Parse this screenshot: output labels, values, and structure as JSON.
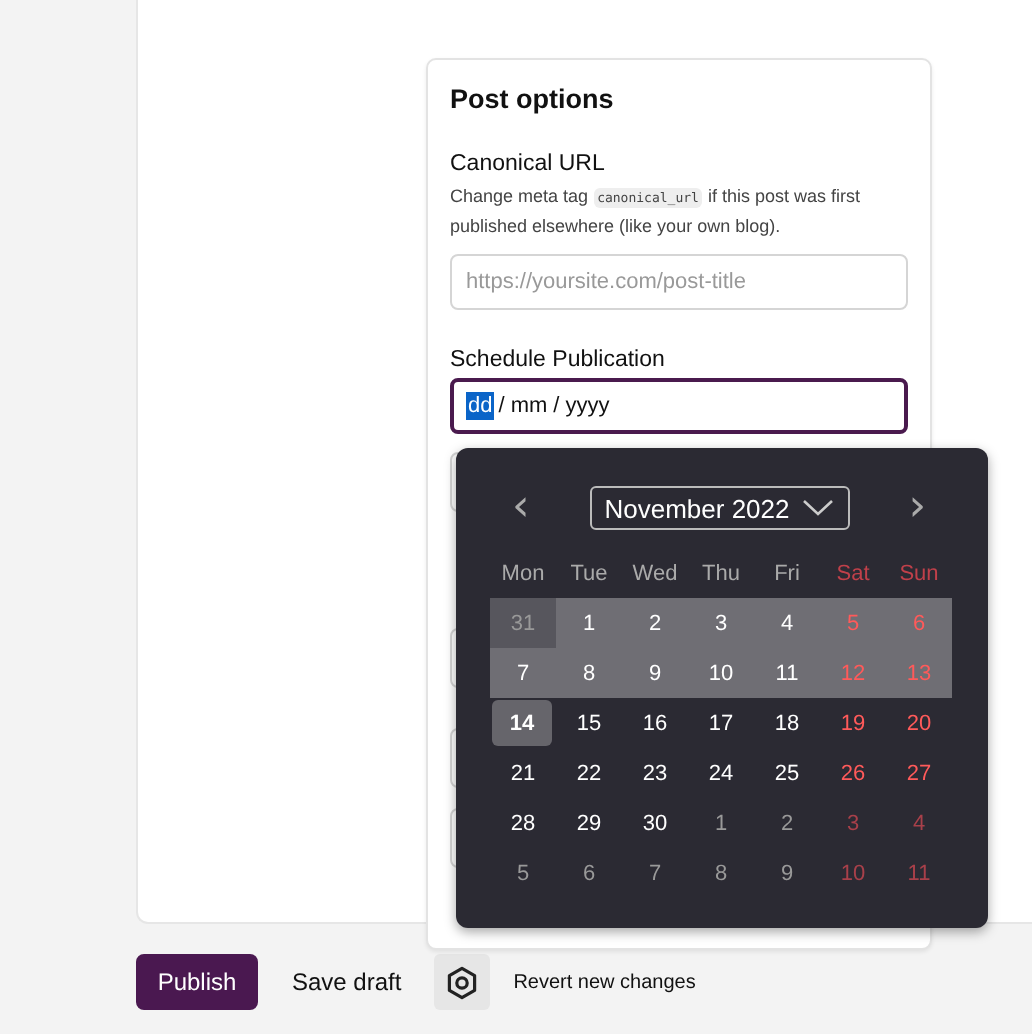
{
  "post_options": {
    "title": "Post options",
    "canonical_url": {
      "label": "Canonical URL",
      "help_before": "Change meta tag",
      "help_code": "canonical_url",
      "help_after": "if this post was first published elsewhere (like your own blog).",
      "placeholder": "https://yoursite.com/post-title"
    },
    "schedule": {
      "label": "Schedule Publication",
      "value_parts": [
        {
          "text": "dd",
          "selected": true
        },
        {
          "text": "/",
          "selected": false
        },
        {
          "text": "mm",
          "selected": false
        },
        {
          "text": "/",
          "selected": false
        },
        {
          "text": "yyyy",
          "selected": false
        }
      ]
    }
  },
  "calendar": {
    "month": "November 2022",
    "prev": "‹",
    "next": "›",
    "weekdays": [
      {
        "text": "Mon",
        "weekend": false
      },
      {
        "text": "Tue",
        "weekend": false
      },
      {
        "text": "Wed",
        "weekend": false
      },
      {
        "text": "Thu",
        "weekend": false
      },
      {
        "text": "Fri",
        "weekend": false
      },
      {
        "text": "Sat",
        "weekend": true
      },
      {
        "text": "Sun",
        "weekend": true
      }
    ],
    "weeks": [
      [
        {
          "day": "31",
          "in_month": false,
          "in_range": true,
          "selected": false
        },
        {
          "day": "1",
          "in_month": true,
          "in_range": true,
          "selected": false
        },
        {
          "day": "2",
          "in_month": true,
          "in_range": true,
          "selected": false
        },
        {
          "day": "3",
          "in_month": true,
          "in_range": true,
          "selected": false
        },
        {
          "day": "4",
          "in_month": true,
          "in_range": true,
          "selected": false
        },
        {
          "day": "5",
          "in_month": true,
          "in_range": true,
          "selected": false
        },
        {
          "day": "6",
          "in_month": true,
          "in_range": true,
          "selected": false
        }
      ],
      [
        {
          "day": "7",
          "in_month": true,
          "in_range": true,
          "selected": false
        },
        {
          "day": "8",
          "in_month": true,
          "in_range": true,
          "selected": false
        },
        {
          "day": "9",
          "in_month": true,
          "in_range": true,
          "selected": false
        },
        {
          "day": "10",
          "in_month": true,
          "in_range": true,
          "selected": false
        },
        {
          "day": "11",
          "in_month": true,
          "in_range": true,
          "selected": false
        },
        {
          "day": "12",
          "in_month": true,
          "in_range": true,
          "selected": false
        },
        {
          "day": "13",
          "in_month": true,
          "in_range": true,
          "selected": false
        }
      ],
      [
        {
          "day": "14",
          "in_month": true,
          "in_range": false,
          "selected": true
        },
        {
          "day": "15",
          "in_month": true,
          "in_range": false,
          "selected": false
        },
        {
          "day": "16",
          "in_month": true,
          "in_range": false,
          "selected": false
        },
        {
          "day": "17",
          "in_month": true,
          "in_range": false,
          "selected": false
        },
        {
          "day": "18",
          "in_month": true,
          "in_range": false,
          "selected": false
        },
        {
          "day": "19",
          "in_month": true,
          "in_range": false,
          "selected": false
        },
        {
          "day": "20",
          "in_month": true,
          "in_range": false,
          "selected": false
        }
      ],
      [
        {
          "day": "21",
          "in_month": true,
          "in_range": false,
          "selected": false
        },
        {
          "day": "22",
          "in_month": true,
          "in_range": false,
          "selected": false
        },
        {
          "day": "23",
          "in_month": true,
          "in_range": false,
          "selected": false
        },
        {
          "day": "24",
          "in_month": true,
          "in_range": false,
          "selected": false
        },
        {
          "day": "25",
          "in_month": true,
          "in_range": false,
          "selected": false
        },
        {
          "day": "26",
          "in_month": true,
          "in_range": false,
          "selected": false
        },
        {
          "day": "27",
          "in_month": true,
          "in_range": false,
          "selected": false
        }
      ],
      [
        {
          "day": "28",
          "in_month": true,
          "in_range": false,
          "selected": false
        },
        {
          "day": "29",
          "in_month": true,
          "in_range": false,
          "selected": false
        },
        {
          "day": "30",
          "in_month": true,
          "in_range": false,
          "selected": false
        },
        {
          "day": "1",
          "in_month": false,
          "in_range": false,
          "selected": false
        },
        {
          "day": "2",
          "in_month": false,
          "in_range": false,
          "selected": false
        },
        {
          "day": "3",
          "in_month": false,
          "in_range": false,
          "selected": false
        },
        {
          "day": "4",
          "in_month": false,
          "in_range": false,
          "selected": false
        }
      ],
      [
        {
          "day": "5",
          "in_month": false,
          "in_range": false,
          "selected": false
        },
        {
          "day": "6",
          "in_month": false,
          "in_range": false,
          "selected": false
        },
        {
          "day": "7",
          "in_month": false,
          "in_range": false,
          "selected": false
        },
        {
          "day": "8",
          "in_month": false,
          "in_range": false,
          "selected": false
        },
        {
          "day": "9",
          "in_month": false,
          "in_range": false,
          "selected": false
        },
        {
          "day": "10",
          "in_month": false,
          "in_range": false,
          "selected": false
        },
        {
          "day": "11",
          "in_month": false,
          "in_range": false,
          "selected": false
        }
      ]
    ]
  },
  "footer": {
    "publish": "Publish",
    "save_draft": "Save draft",
    "revert": "Revert new changes"
  }
}
